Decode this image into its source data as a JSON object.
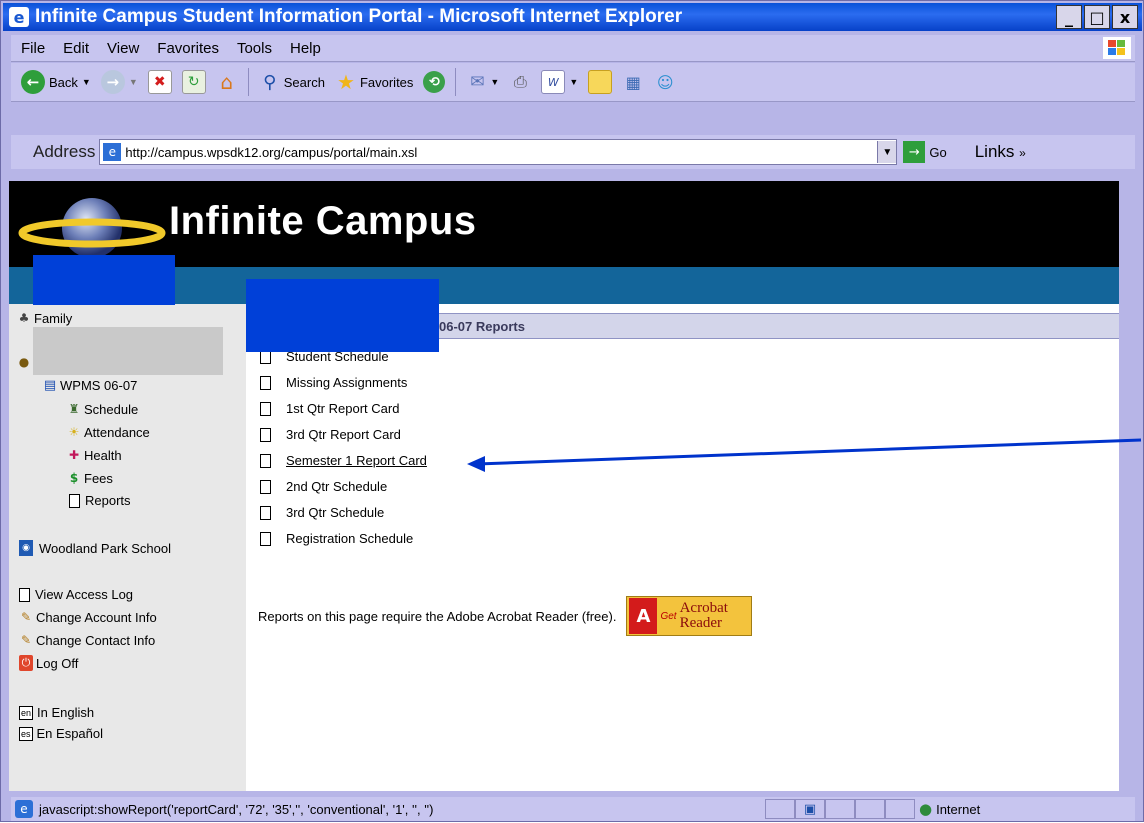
{
  "window": {
    "title": "Infinite Campus Student Information Portal - Microsoft Internet Explorer",
    "controls": [
      "_",
      "□",
      "x"
    ]
  },
  "menu": {
    "items": [
      "File",
      "Edit",
      "View",
      "Favorites",
      "Tools",
      "Help"
    ]
  },
  "toolbar": {
    "back_label": "Back",
    "search_label": "Search",
    "favorites_label": "Favorites"
  },
  "address": {
    "label": "Address",
    "url": "http://campus.wpsdk12.org/campus/portal/main.xsl",
    "go_label": "Go",
    "links_label": "Links"
  },
  "banner": {
    "brand": "Infinite Campus"
  },
  "sidebar": {
    "family_label": "Family",
    "school_year_label": "WPMS 06-07",
    "sub_items": [
      "Schedule",
      "Attendance",
      "Health",
      "Fees",
      "Reports"
    ],
    "school_label": "Woodland Park School",
    "account_links": [
      "View Access Log",
      "Change Account Info",
      "Change Contact Info",
      "Log Off"
    ],
    "languages": [
      {
        "code": "en",
        "label": "In English"
      },
      {
        "code": "es",
        "label": "En Español"
      }
    ]
  },
  "content": {
    "section_title": "06-07 Reports",
    "reports": [
      "Student Schedule",
      "Missing Assignments",
      "1st Qtr Report Card",
      "3rd Qtr Report Card",
      "Semester 1 Report Card",
      "2nd Qtr Schedule",
      "3rd Qtr Schedule",
      "Registration Schedule"
    ],
    "highlighted_report_index": 4,
    "acrobat_note": "Reports on this page require the Adobe Acrobat Reader (free).",
    "acrobat_badge": {
      "get": "Get",
      "line1": "Acrobat",
      "line2": "Reader",
      "brand": "Adobe"
    }
  },
  "status": {
    "text": "javascript:showReport('reportCard', '72', '35','', 'conventional', '1', '', '')",
    "zone": "Internet"
  },
  "colors": {
    "title_bar": "#0a52d8",
    "nav_bar": "#13659a",
    "redaction": "#0040d8",
    "annotation_arrow": "#0033cc"
  }
}
